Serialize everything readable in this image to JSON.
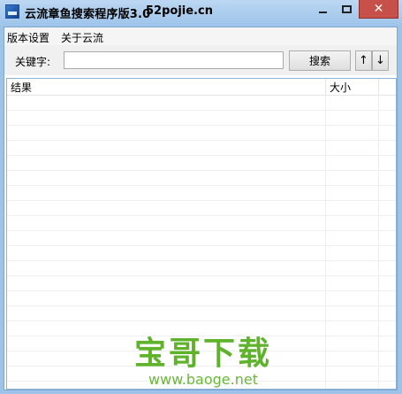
{
  "window": {
    "title": "云流章鱼搜索程序版3.0",
    "site": "52pojie.cn",
    "close_glyph": "✕"
  },
  "menu": {
    "items": [
      "版本设置",
      "关于云流"
    ]
  },
  "toolbar": {
    "keyword_label": "关键字:",
    "keyword_value": "",
    "search_label": "搜索",
    "up_label": "↑",
    "down_label": "↓"
  },
  "results": {
    "columns": [
      "结果",
      "大小"
    ],
    "rows": []
  },
  "watermark": {
    "main": "宝哥下载",
    "sub": "www.baoge.net"
  },
  "colors": {
    "titlebar": "#9ec4ea",
    "close_button": "#c7504b",
    "watermark": "#5fb32b"
  }
}
